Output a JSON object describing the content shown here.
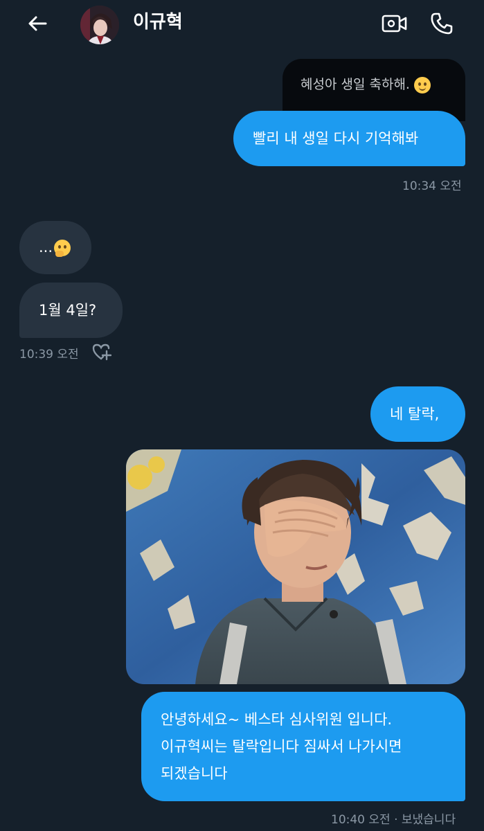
{
  "header": {
    "contact_name": "이규혁",
    "icons": {
      "back": "arrow-left-icon",
      "video": "video-camera-icon",
      "call": "phone-icon"
    }
  },
  "messages": {
    "quoted_text": "혜성아 생일 축하해.",
    "quoted_emoji": "smirking-face-emoji",
    "sent_1": "빨리 내 생일 다시 기억해봐",
    "time_1": "10:34 오전",
    "received_1_text": "...",
    "received_1_emoji": "thinking-face-emoji",
    "received_2": "1월 4일?",
    "time_2": "10:39 오전",
    "sent_2": "네 탈락,",
    "photo_alt": "person covering face with hand",
    "sent_3_lines": [
      "안녕하세요~ 베스타 심사위원 입니다.",
      "이규혁씨는 탈락입니다 짐싸서 나가시면",
      "되겠습니다"
    ],
    "time_3": "10:40 오전 · 보냈습니다"
  },
  "colors": {
    "background": "#15202b",
    "sent_bubble": "#1d9bf0",
    "received_bubble": "#273340",
    "timestamp": "#8b98a5"
  }
}
